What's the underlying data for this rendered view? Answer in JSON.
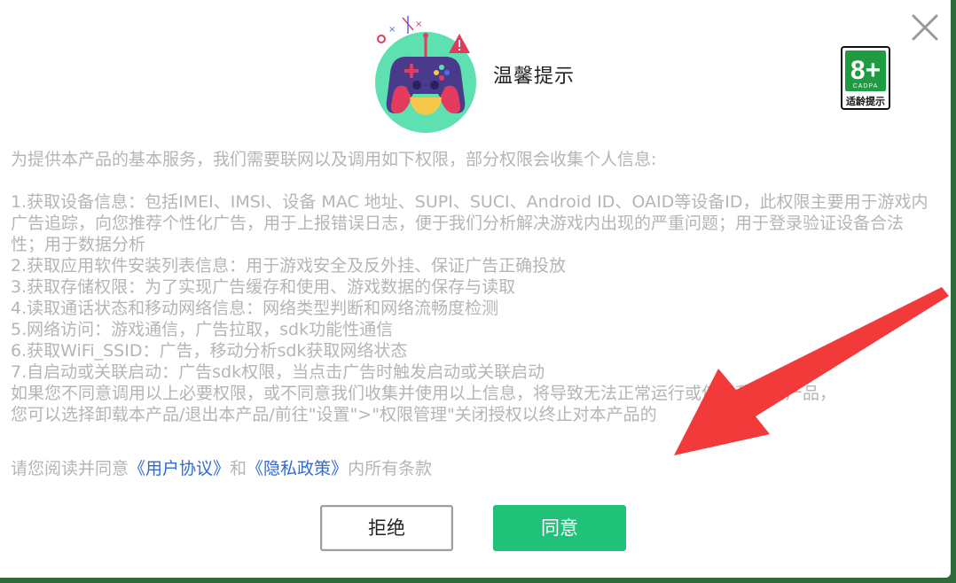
{
  "dialog": {
    "title": "温馨提示",
    "close_icon": "close-icon",
    "age_rating": {
      "label": "8+",
      "org": "CADPA",
      "caption": "适龄提示",
      "color": "#1f9c42"
    },
    "intro": "为提供本产品的基本服务，我们需要联网以及调用如下权限，部分权限会收集个人信息:",
    "permissions": [
      "1.获取设备信息：包括IMEI、IMSI、设备 MAC 地址、SUPI、SUCI、Android ID、OAID等设备ID，此权限主要用于游戏内广告追踪，向您推荐个性化广告，用于上报错误日志，便于我们分析解决游戏内出现的严重问题；用于登录验证设备合法性；用于数据分析",
      "2.获取应用软件安装列表信息：用于游戏安全及反外挂、保证广告正确投放",
      "3.获取存储权限：为了实现广告缓存和使用、游戏数据的保存与读取",
      "4.读取通话状态和移动网络信息：网络类型判断和网络流畅度检测",
      "5.网络访问：游戏通信，广告拉取，sdk功能性通信",
      "6.获取WiFi_SSID：广告，移动分析sdk获取网络状态",
      "7.自启动或关联启动：广告sdk权限，当点击广告时触发启动或关联启动"
    ],
    "disclaimer_1": "如果您不同意调用以上必要权限，或不同意我们收集并使用以上信息，将导致无法正常运行或使用我们的产品，",
    "disclaimer_2": "您可以选择卸载本产品/退出本产品/前往\"设置\">\"权限管理\"关闭授权以终止对本产品的",
    "consent": {
      "prefix": "请您阅读并同意",
      "user_agreement": "《用户协议》",
      "and": "和",
      "privacy_policy": "《隐私政策》",
      "suffix": "内所有条款"
    },
    "buttons": {
      "reject": "拒绝",
      "agree": "同意"
    }
  },
  "colors": {
    "agree_button": "#20c178",
    "link": "#2d6bd6",
    "body_text": "#b5b5b5",
    "annotation_arrow": "#f23a3a"
  }
}
